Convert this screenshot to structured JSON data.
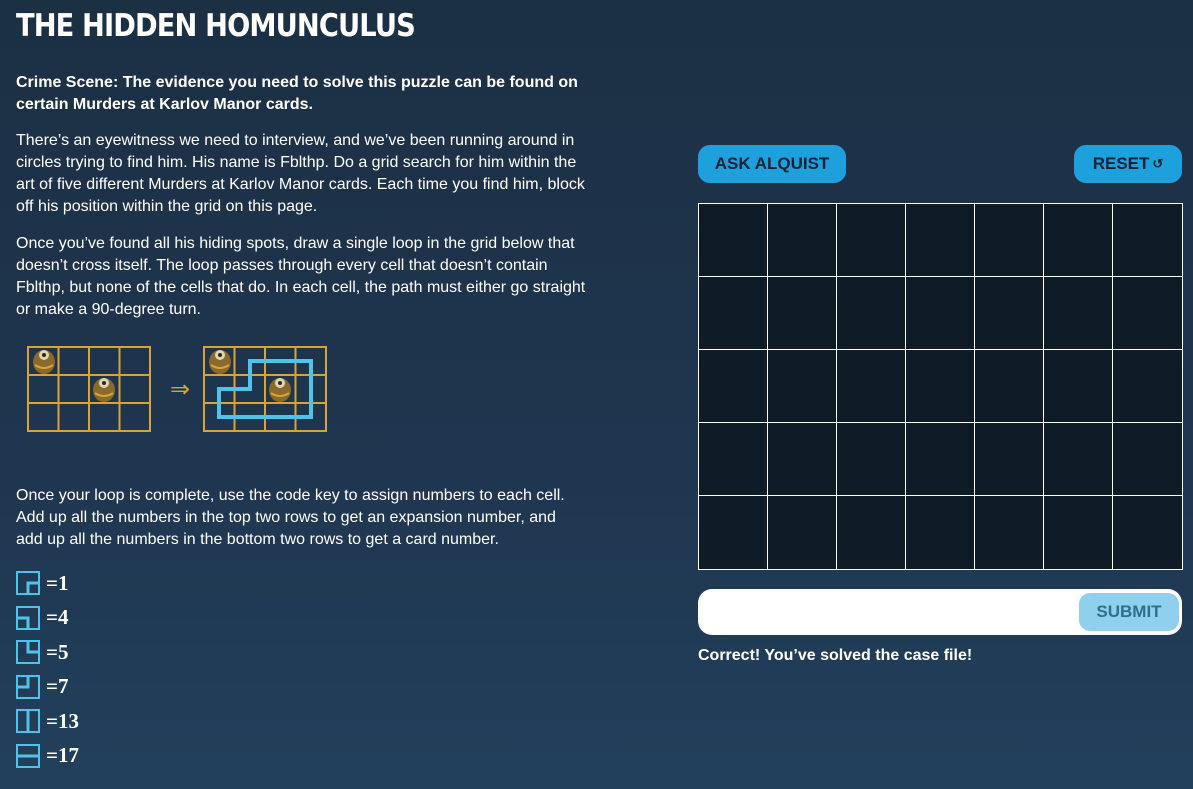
{
  "header": {
    "title": "THE HIDDEN HOMUNCULUS"
  },
  "intro": {
    "lead": "Crime Scene: The evidence you need to solve this puzzle can be found on certain Murders at Karlov Manor cards.",
    "paragraphs": [
      "There’s an eyewitness we need to interview, and we’ve been running around in circles trying to find him. His name is Fblthp. Do a grid search for him within the art of five different Murders at Karlov Manor cards. Each time you find him, block off his position within the grid on this page.",
      "Once you’ve found all his hiding spots, draw a single loop in the grid below that doesn’t cross itself. The loop passes through every cell that doesn’t contain Fblthp, but none of the cells that do. In each cell, the path must either go straight or make a 90-degree turn.",
      "Once your loop is complete, use the code key to assign numbers to each cell. Add up all the numbers in the top two rows to get an expansion number, and add up all the numbers in the bottom two rows to get a card number."
    ]
  },
  "example": {
    "arrow": "⇒",
    "grid_color": "#d9a431",
    "loop_color": "#4fc3ea",
    "fblthp_icon": "fblthp-icon"
  },
  "code_key": [
    {
      "icon": "turn-right-down-icon",
      "label": "=1"
    },
    {
      "icon": "turn-left-down-icon",
      "label": "=4"
    },
    {
      "icon": "turn-up-right-icon",
      "label": "=5"
    },
    {
      "icon": "turn-up-left-icon",
      "label": "=7"
    },
    {
      "icon": "vertical-straight-icon",
      "label": "=13"
    },
    {
      "icon": "horizontal-straight-icon",
      "label": "=17"
    }
  ],
  "actions": {
    "ask_label": "ASK ALQUIST",
    "reset_label": "RESET",
    "reset_icon": "↺"
  },
  "puzzle_grid": {
    "rows": 5,
    "cols": 7
  },
  "answer": {
    "value": "",
    "placeholder": "",
    "submit_label": "SUBMIT"
  },
  "result": {
    "message": "Correct! You’ve solved the case file!"
  },
  "colors": {
    "accent": "#1ea0dc",
    "submit_disabled": "#8fd0ec",
    "grid_bg": "#0f1c27",
    "page_bg": "#1f3650"
  }
}
